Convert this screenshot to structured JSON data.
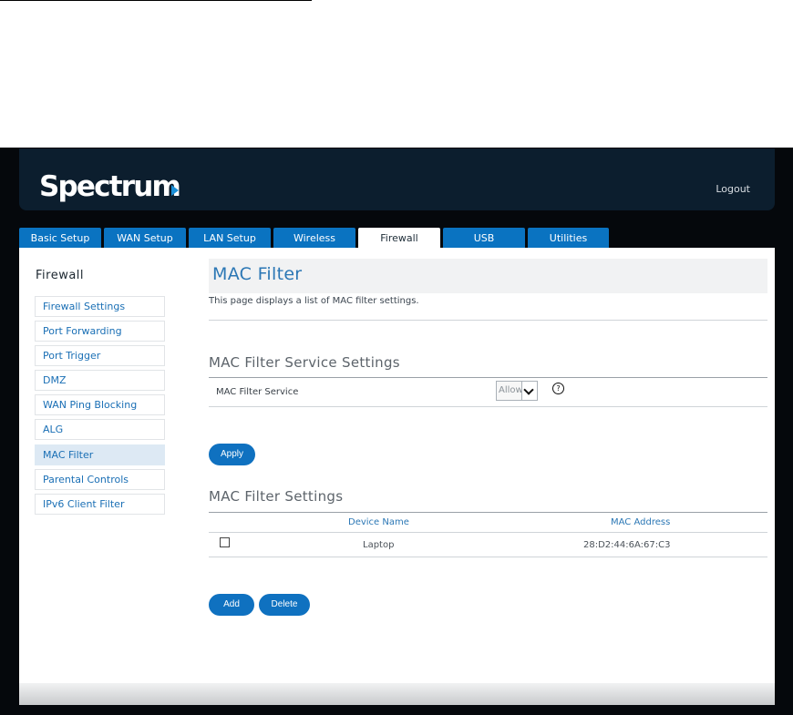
{
  "header": {
    "brand": "Spectrum",
    "logout_label": "Logout"
  },
  "tabs": [
    {
      "label": "Basic Setup"
    },
    {
      "label": "WAN Setup"
    },
    {
      "label": "LAN Setup"
    },
    {
      "label": "Wireless"
    },
    {
      "label": "Firewall",
      "active": true
    },
    {
      "label": "USB"
    },
    {
      "label": "Utilities"
    }
  ],
  "sidebar": {
    "title": "Firewall",
    "items": [
      {
        "label": "Firewall Settings"
      },
      {
        "label": "Port Forwarding"
      },
      {
        "label": "Port Trigger"
      },
      {
        "label": "DMZ"
      },
      {
        "label": "WAN Ping Blocking"
      },
      {
        "label": "ALG"
      },
      {
        "label": "MAC Filter",
        "active": true
      },
      {
        "label": "Parental Controls"
      },
      {
        "label": "IPv6 Client Filter"
      }
    ]
  },
  "page": {
    "title": "MAC Filter",
    "description": "This page displays a list of MAC filter settings."
  },
  "service_settings": {
    "title": "MAC Filter Service Settings",
    "label": "MAC Filter Service",
    "selected": "Allow",
    "help_glyph": "?",
    "apply_label": "Apply"
  },
  "filter_settings": {
    "title": "MAC Filter Settings",
    "columns": [
      "Device Name",
      "MAC Address"
    ],
    "rows": [
      {
        "device_name": "Laptop",
        "mac_address": "28:D2:44:6A:67:C3",
        "checked": false
      }
    ],
    "add_label": "Add",
    "delete_label": "Delete"
  },
  "colors": {
    "accent": "#0f71c0",
    "header_bg": "#0c1e2e",
    "title_blue": "#2b77b5"
  },
  "icons": {
    "help": "help-circle-icon",
    "dropdown": "chevron-down-icon",
    "logo_arrow": "play-triangle-icon"
  }
}
